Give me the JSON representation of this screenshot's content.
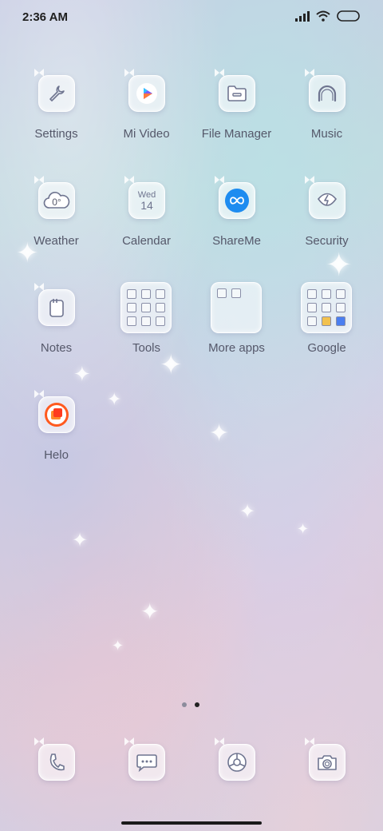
{
  "status_bar": {
    "time": "2:36 AM",
    "icons": [
      "signal-icon",
      "wifi-icon",
      "battery-icon"
    ]
  },
  "apps": [
    {
      "label": "Settings",
      "icon": "wrench-icon"
    },
    {
      "label": "Mi Video",
      "icon": "play-icon"
    },
    {
      "label": "File Manager",
      "icon": "folder-icon"
    },
    {
      "label": "Music",
      "icon": "headphones-icon"
    },
    {
      "label": "Weather",
      "icon": "cloud-icon",
      "icon_text": "0°"
    },
    {
      "label": "Calendar",
      "icon": "calendar-icon",
      "icon_day": "Wed",
      "icon_date": "14"
    },
    {
      "label": "ShareMe",
      "icon": "infinity-icon"
    },
    {
      "label": "Security",
      "icon": "shield-bolt-icon"
    },
    {
      "label": "Notes",
      "icon": "notepad-icon"
    },
    {
      "label": "Tools",
      "icon": "folder-tools-icon"
    },
    {
      "label": "More apps",
      "icon": "folder-more-apps-icon"
    },
    {
      "label": "Google",
      "icon": "folder-google-icon"
    },
    {
      "label": "Helo",
      "icon": "helo-icon"
    }
  ],
  "page_indicator": {
    "pages": 2,
    "current": 2
  },
  "dock": [
    {
      "name": "phone",
      "icon": "phone-icon"
    },
    {
      "name": "messages",
      "icon": "message-icon"
    },
    {
      "name": "browser",
      "icon": "browser-icon"
    },
    {
      "name": "camera",
      "icon": "camera-icon"
    }
  ],
  "colors": {
    "label": "#55586a",
    "icon_stroke": "#6f7590",
    "mi_video_play": "#7b5cff",
    "shareme_blue": "#1d8cf0",
    "helo_orange": "#ff5a1f",
    "dot_active": "#222222",
    "dot_inactive": "#8c8c9c"
  }
}
